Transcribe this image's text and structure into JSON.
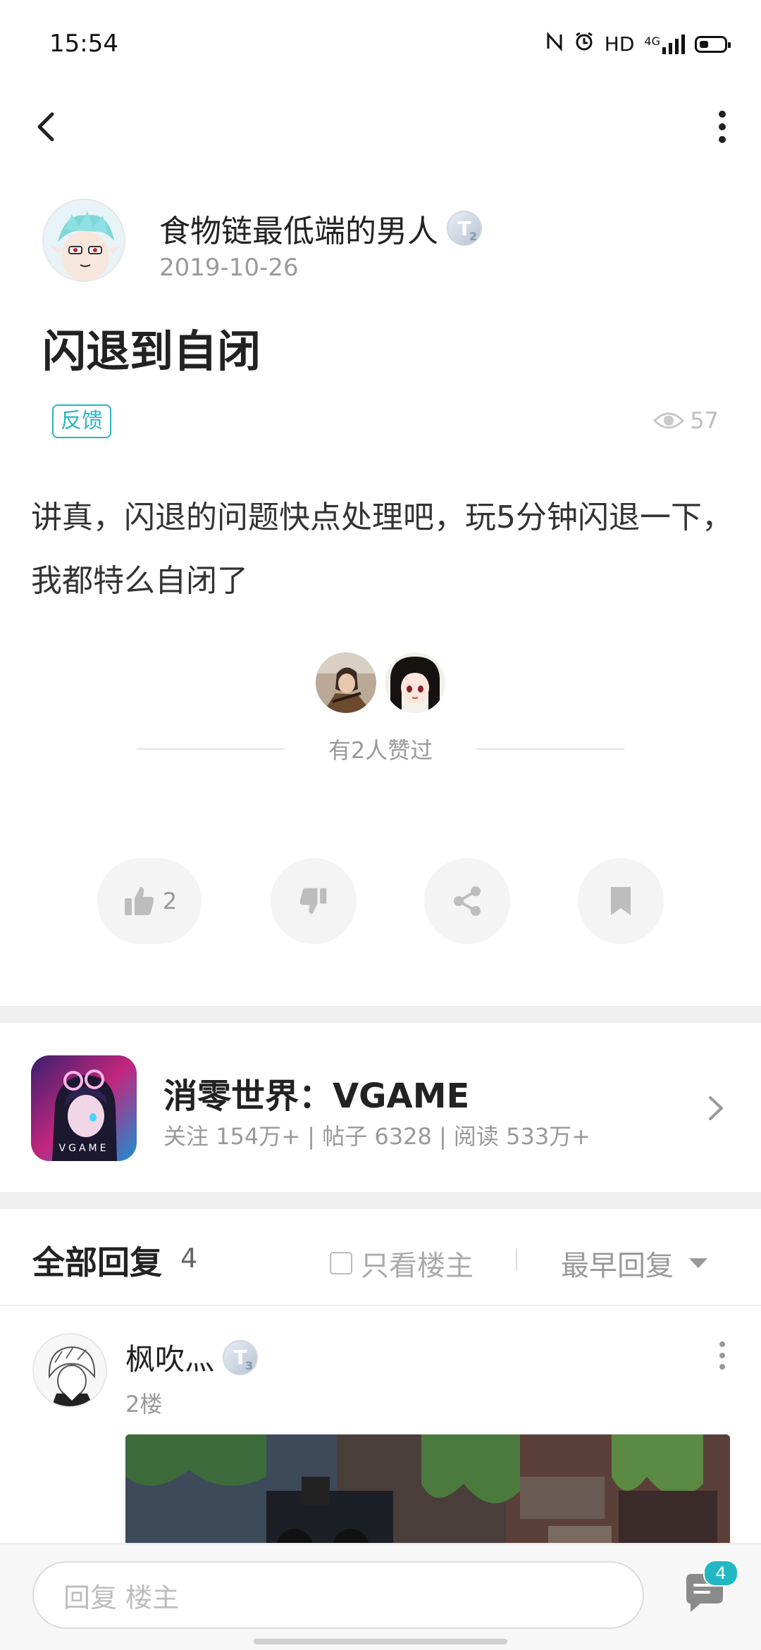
{
  "status_bar": {
    "time": "15:54",
    "network": "4G",
    "hd": "HD",
    "battery_level": 0.35
  },
  "post": {
    "author": {
      "name": "食物链最低端的男人",
      "level_letter": "T",
      "level_num": "2",
      "date": "2019-10-26"
    },
    "title": "闪退到自闭",
    "tag": "反馈",
    "views": "57",
    "body": "讲真，闪退的问题快点处理吧，玩5分钟闪退一下，我都特么自闭了",
    "likes_text": "有2人赞过",
    "like_count": "2"
  },
  "forum": {
    "name": "消零世界：VGAME",
    "stats": "关注 154万+ | 帖子 6328 | 阅读 533万+",
    "icon_text": "VGAME"
  },
  "replies": {
    "title": "全部回复",
    "count": "4",
    "only_owner": "只看楼主",
    "sort": "最早回复",
    "items": [
      {
        "name": "枫吹灬",
        "level_letter": "T",
        "level_num": "3",
        "floor": "2楼"
      }
    ]
  },
  "bottom_bar": {
    "placeholder": "回复 楼主",
    "comment_badge": "4"
  },
  "colors": {
    "accent": "#2bb5bf",
    "badge": "#22b8c3",
    "divider": "#efefef"
  }
}
